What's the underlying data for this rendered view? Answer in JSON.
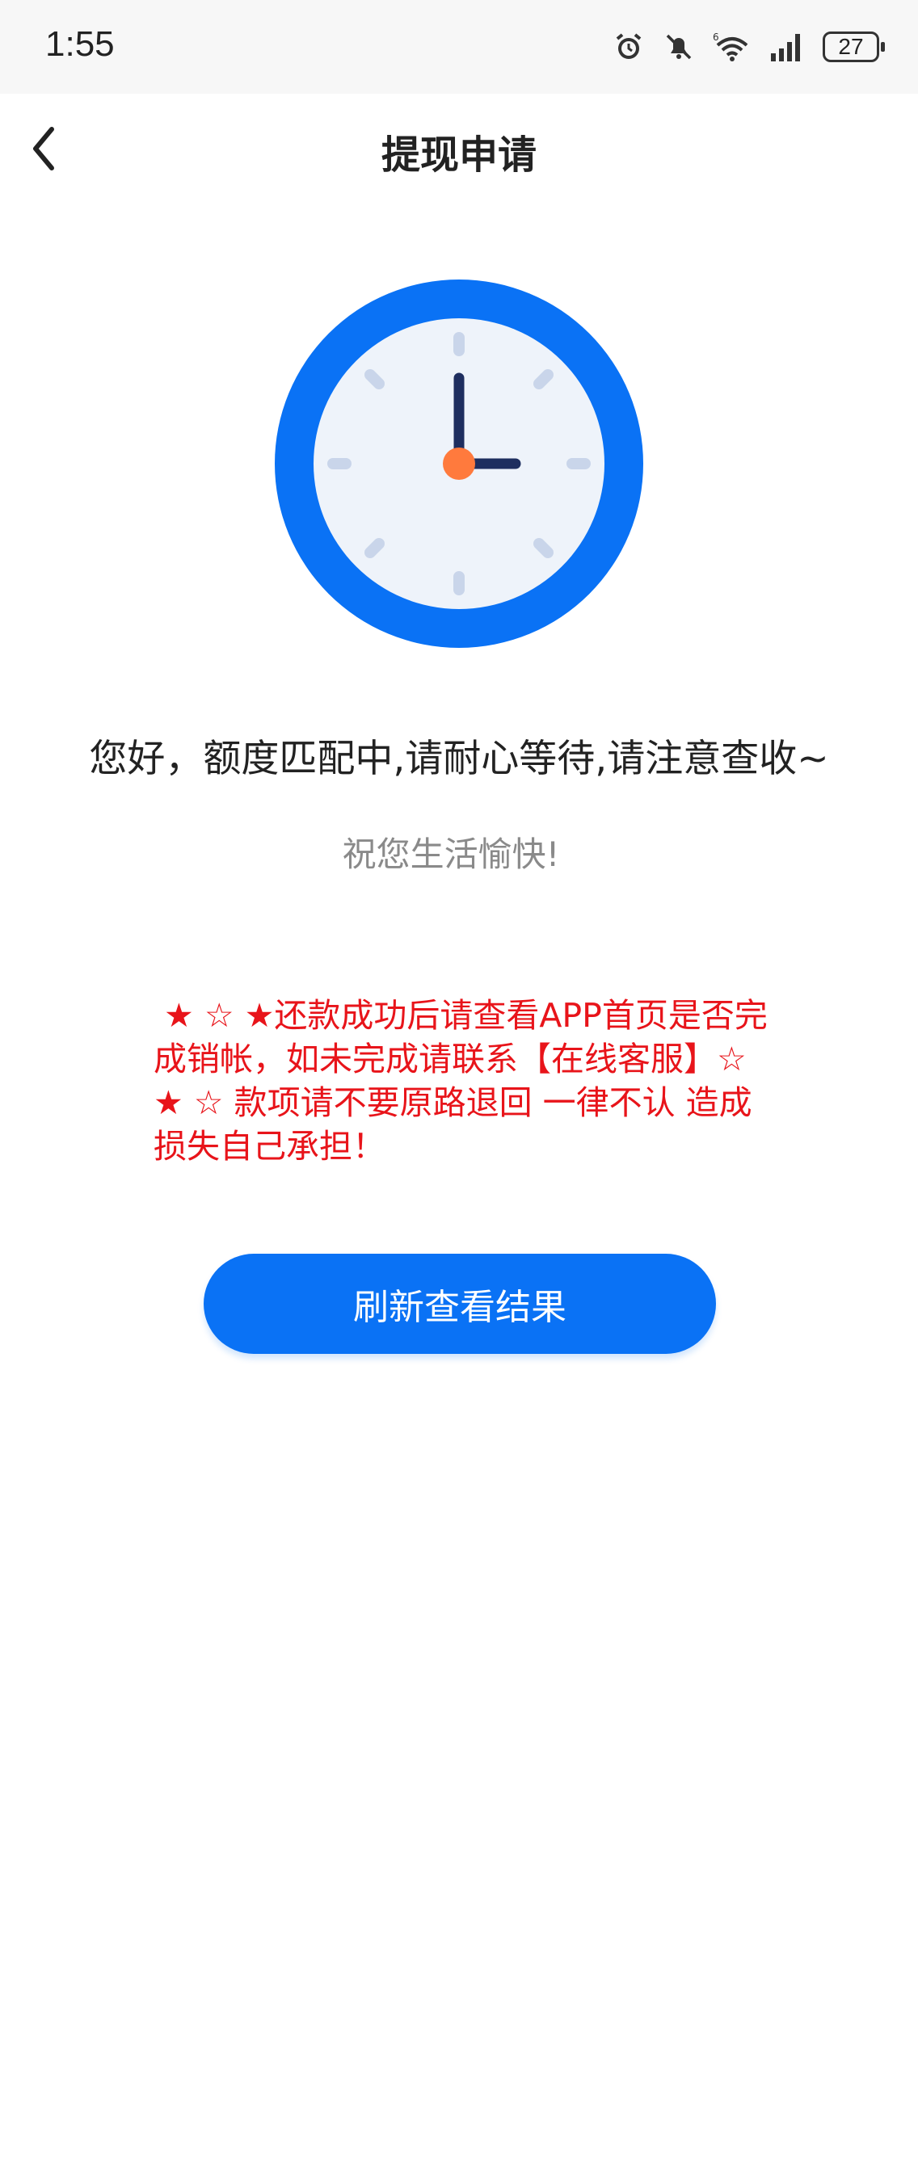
{
  "status_bar": {
    "time": "1:55",
    "battery": "27",
    "icons": [
      "alarm-icon",
      "silent-icon",
      "wifi-icon",
      "signal-icon",
      "battery-icon"
    ]
  },
  "header": {
    "title": "提现申请",
    "back_icon": "chevron-left-icon"
  },
  "illustration": {
    "icon": "clock-icon",
    "colors": {
      "ring": "#0a72f5",
      "face": "#eef3fa",
      "hands": "#1e2e5f",
      "center": "#ff7a3d",
      "ticks": "#c9d5ea"
    }
  },
  "content": {
    "main_message": "您好，额度匹配中,请耐心等待,请注意查收~",
    "sub_message": "祝您生活愉快!",
    "notice": " ★ ☆ ★还款成功后请查看APP首页是否完成销帐，如未完成请联系【在线客服】☆ ★ ☆ 款项请不要原路退回 一律不认 造成损失自己承担！"
  },
  "actions": {
    "refresh_label": "刷新查看结果"
  },
  "colors": {
    "accent": "#0a72f5",
    "notice": "#e8141a"
  }
}
